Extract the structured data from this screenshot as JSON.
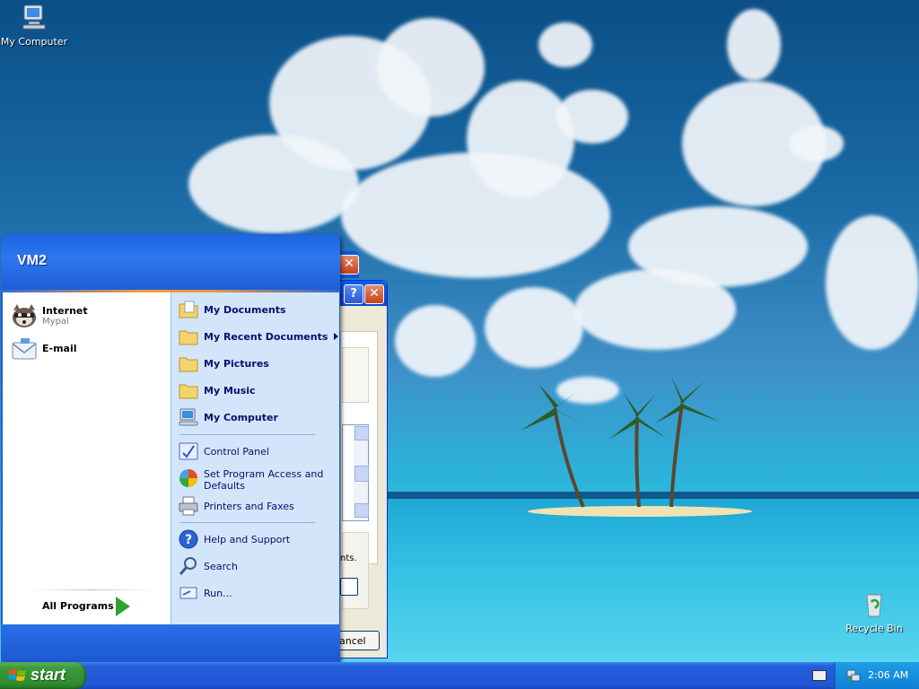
{
  "desktop": {
    "icons": [
      {
        "label": "My Computer"
      },
      {
        "label": "Recycle Bin"
      }
    ]
  },
  "startmenu": {
    "user": "VM2",
    "pinned": [
      {
        "title": "Internet",
        "subtitle": "Mypal"
      },
      {
        "title": "E-mail",
        "subtitle": ""
      }
    ],
    "all_programs": "All Programs",
    "places": [
      {
        "label": "My Documents"
      },
      {
        "label": "My Recent Documents"
      },
      {
        "label": "My Pictures"
      },
      {
        "label": "My Music"
      },
      {
        "label": "My Computer"
      }
    ],
    "settings": [
      {
        "label": "Control Panel"
      },
      {
        "label": "Set Program Access and Defaults"
      },
      {
        "label": "Printers and Faxes"
      }
    ],
    "tools": [
      {
        "label": "Help and Support"
      },
      {
        "label": "Search"
      },
      {
        "label": "Run..."
      }
    ]
  },
  "background_window": {
    "close_glyph": "✕",
    "help_glyph": "?",
    "text_fragment": "nts.",
    "button_fragment": "ancel"
  },
  "taskbar": {
    "start_label": "start",
    "clock": "2:06 AM"
  },
  "colors": {
    "xp_blue": "#245edb",
    "start_green": "#3c9b3c",
    "menu_right_bg": "#d3e5fa"
  }
}
